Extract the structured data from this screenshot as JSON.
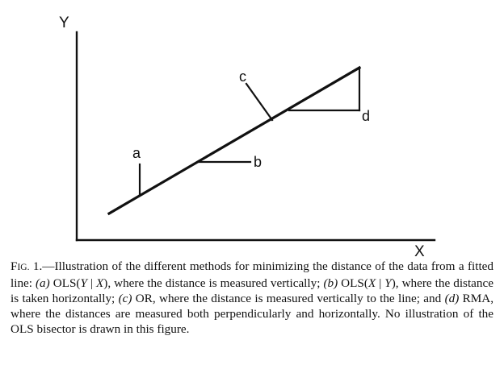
{
  "figure": {
    "axes": {
      "y_label": "Y",
      "x_label": "X"
    },
    "labels": {
      "a": "a",
      "b": "b",
      "c": "c",
      "d": "d"
    }
  },
  "caption": {
    "fig_first_letter": "F",
    "fig_small_caps": "IG.",
    "fig_number": "1.—",
    "text_1": "Illustration of the different methods for minimizing the distance of the data from a fitted line: ",
    "item_a_marker": "(a)",
    "item_a_method_1": " OLS(",
    "item_a_var_1": "Y",
    "item_a_bar": " | ",
    "item_a_var_2": "X",
    "item_a_text": "), where the distance is measured vertically; ",
    "item_b_marker": "(b)",
    "item_b_method_1": " OLS(",
    "item_b_var_1": "X",
    "item_b_bar": " | ",
    "item_b_var_2": "Y",
    "item_b_text": "), where the distance is taken horizontally; ",
    "item_c_marker": "(c)",
    "item_c_text": " OR, where the distance is measured vertically to the line; and ",
    "item_d_marker": "(d)",
    "item_d_text": " RMA, where the distances are measured both perpendicularly and horizontally. No illustration of the OLS bisector is drawn in this figure."
  }
}
